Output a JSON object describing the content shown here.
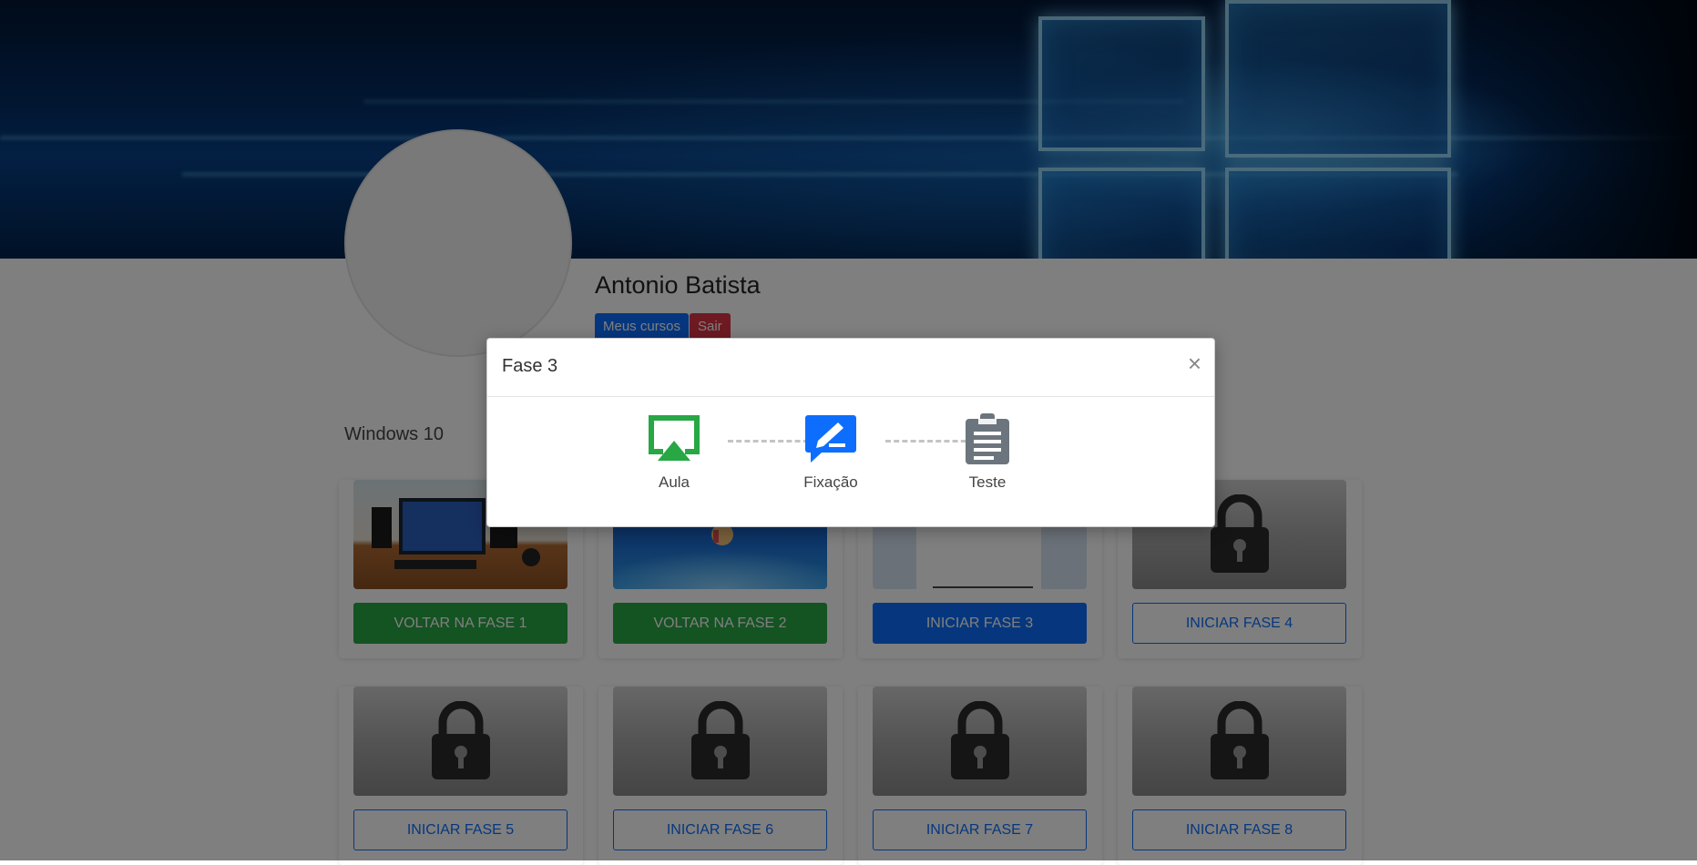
{
  "profile": {
    "name": "Antonio Batista",
    "courses_button": "Meus cursos",
    "exit_button": "Sair"
  },
  "course": {
    "title": "Windows 10",
    "phases": [
      {
        "label": "VOLTAR NA FASE 1",
        "state": "completed"
      },
      {
        "label": "VOLTAR NA FASE 2",
        "state": "completed"
      },
      {
        "label": "INICIAR FASE 3",
        "state": "current"
      },
      {
        "label": "INICIAR FASE 4",
        "state": "locked"
      },
      {
        "label": "INICIAR FASE 5",
        "state": "locked"
      },
      {
        "label": "INICIAR FASE 6",
        "state": "locked"
      },
      {
        "label": "INICIAR FASE 7",
        "state": "locked"
      },
      {
        "label": "INICIAR FASE 8",
        "state": "locked"
      }
    ]
  },
  "modal": {
    "title": "Fase 3",
    "close_symbol": "×",
    "steps": [
      {
        "label": "Aula",
        "icon": "cast-icon",
        "color": "#28a745"
      },
      {
        "label": "Fixação",
        "icon": "pencil-message-icon",
        "color": "#0d6efd"
      },
      {
        "label": "Teste",
        "icon": "clipboard-icon",
        "color": "#6c757d"
      }
    ]
  },
  "colors": {
    "primary": "#0d6efd",
    "success": "#28a745",
    "danger": "#dc3545"
  }
}
